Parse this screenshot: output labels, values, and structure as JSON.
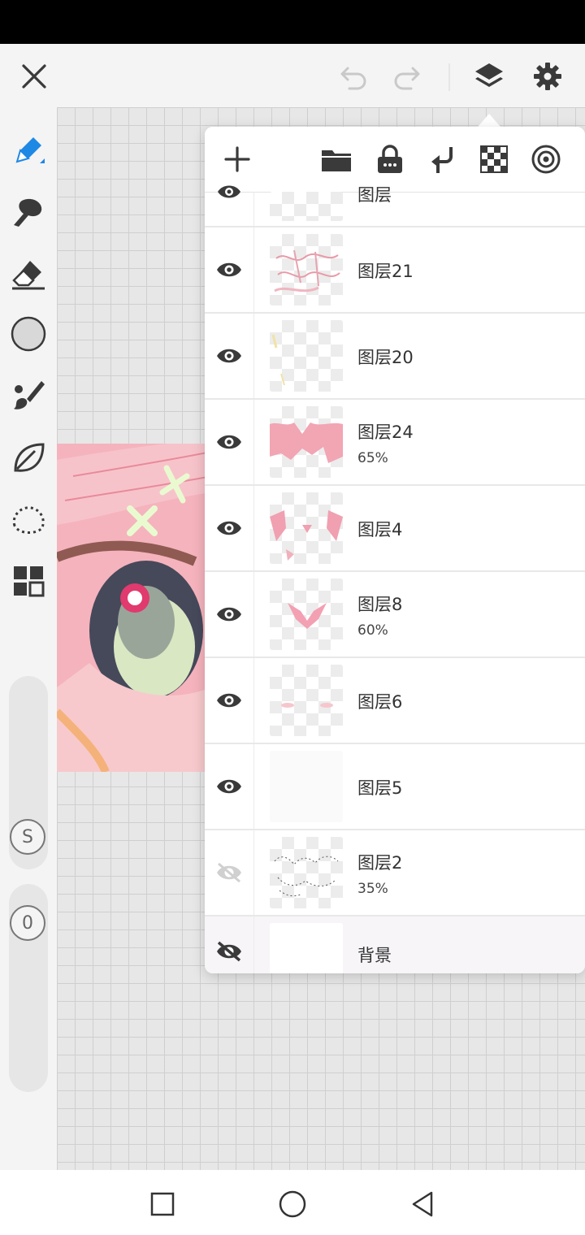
{
  "app": {
    "icons": {
      "close": "close-icon",
      "undo": "undo-icon",
      "redo": "redo-icon",
      "layers": "layers-icon",
      "settings": "gear-icon"
    }
  },
  "toolbar_left": {
    "tools": [
      "pen-icon",
      "brush-icon",
      "eraser-icon",
      "color-circle-icon",
      "fill-brush-icon",
      "leaf-icon",
      "lasso-selection-icon",
      "grid-menu-icon"
    ],
    "size_slider_label": "S",
    "opacity_slider_label": "0"
  },
  "layer_panel": {
    "tools": [
      "add-layer-icon",
      "folder-icon",
      "lock-icon",
      "merge-down-icon",
      "checker-icon",
      "layer-settings-icon"
    ],
    "layers": [
      {
        "name": "图层",
        "opacity": "",
        "visible": true
      },
      {
        "name": "图层21",
        "opacity": "",
        "visible": true
      },
      {
        "name": "图层20",
        "opacity": "",
        "visible": true
      },
      {
        "name": "图层24",
        "opacity": "65%",
        "visible": true
      },
      {
        "name": "图层4",
        "opacity": "",
        "visible": true
      },
      {
        "name": "图层8",
        "opacity": "60%",
        "visible": true
      },
      {
        "name": "图层6",
        "opacity": "",
        "visible": true
      },
      {
        "name": "图层5",
        "opacity": "",
        "visible": true
      },
      {
        "name": "图层2",
        "opacity": "35%",
        "visible": false
      },
      {
        "name": "背景",
        "opacity": "",
        "visible": false
      }
    ]
  },
  "navbar": {
    "buttons": [
      "recent-apps-icon",
      "home-icon",
      "back-icon"
    ]
  },
  "colors": {
    "accent": "#1e88e5",
    "icon": "#3a3a3a",
    "panel_bg": "#ffffff",
    "canvas_bg": "#e7e7e7"
  }
}
